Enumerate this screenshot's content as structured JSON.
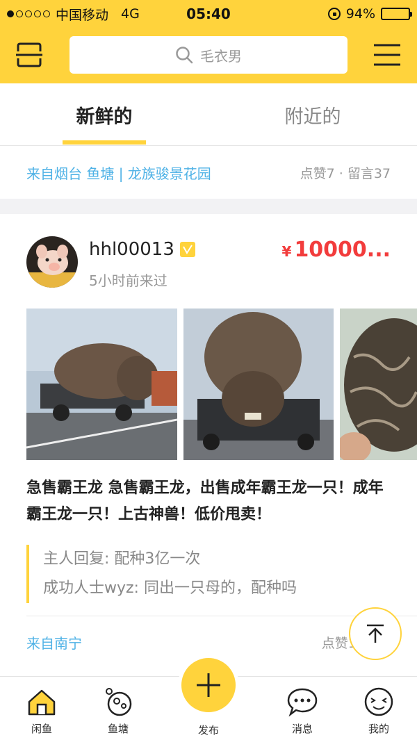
{
  "status_bar": {
    "carrier": "中国移动",
    "network": "4G",
    "time": "05:40",
    "battery": "94%",
    "battery_level": 0.94
  },
  "header": {
    "search_placeholder": "毛衣男"
  },
  "tabs": [
    {
      "label": "新鲜的",
      "active": true
    },
    {
      "label": "附近的",
      "active": false
    }
  ],
  "previous_item": {
    "from": "来自烟台 鱼塘 | 龙族骏景花园",
    "stats": "点赞7 · 留言37"
  },
  "item": {
    "username": "hhl00013",
    "last_seen": "5小时前来过",
    "price_symbol": "¥",
    "price": "10000...",
    "description": "急售霸王龙 急售霸王龙，出售成年霸王龙一只！成年霸王龙一只！上古神兽！低价甩卖！",
    "comments": [
      "主人回复: 配种3亿一次",
      "成功人士wyz: 同出一只母的，配种吗"
    ],
    "from": "来自南宁",
    "stats": "点赞12 · 留"
  },
  "bottom_nav": [
    {
      "label": "闲鱼",
      "icon": "home-icon"
    },
    {
      "label": "鱼塘",
      "icon": "pond-icon"
    },
    {
      "label": "发布",
      "icon": "plus-icon"
    },
    {
      "label": "消息",
      "icon": "chat-icon"
    },
    {
      "label": "我的",
      "icon": "profile-icon"
    }
  ],
  "colors": {
    "accent": "#ffd33c",
    "price": "#f23c3c",
    "link": "#4fb2e6"
  }
}
